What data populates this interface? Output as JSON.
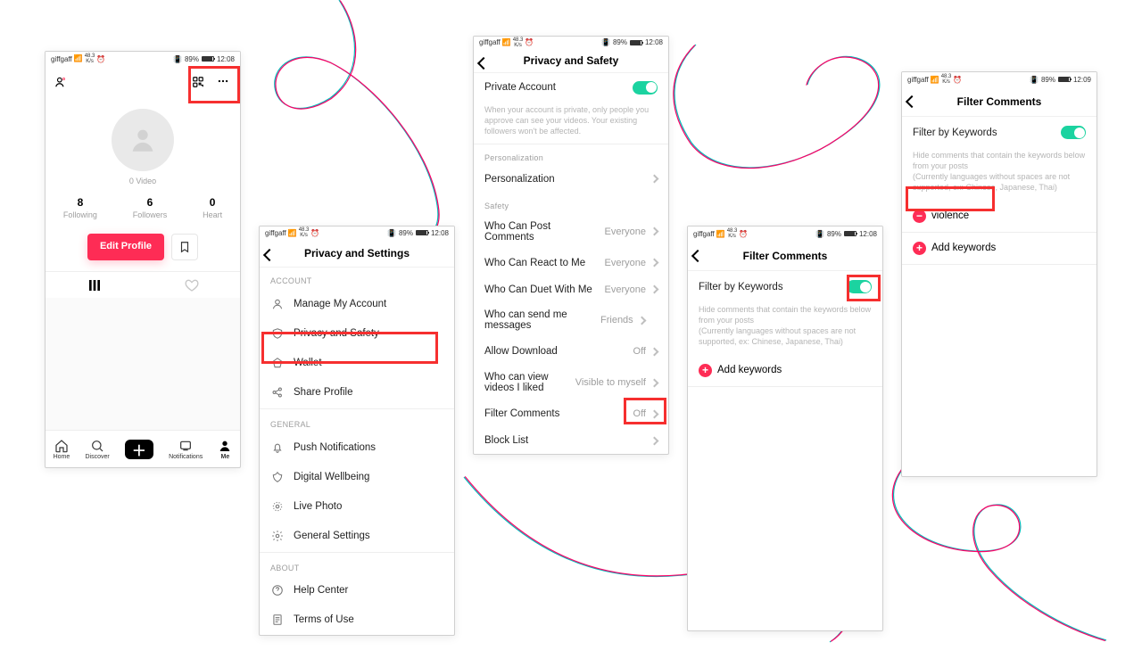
{
  "status": {
    "carrier": "giffgaff",
    "sig": "⁴ᴳ",
    "kb": "48.3",
    "kb_unit": "K/s",
    "battery": "89%",
    "time": "12:08",
    "time_last": "12:09"
  },
  "profile": {
    "video_count": "0 Video",
    "counts": [
      {
        "n": "8",
        "l": "Following"
      },
      {
        "n": "6",
        "l": "Followers"
      },
      {
        "n": "0",
        "l": "Heart"
      }
    ],
    "edit": "Edit Profile",
    "nav": [
      "Home",
      "Discover",
      "",
      "Notifications",
      "Me"
    ]
  },
  "settings": {
    "title": "Privacy and Settings",
    "sections": {
      "account": {
        "label": "ACCOUNT",
        "items": [
          "Manage My Account",
          "Privacy and Safety",
          "Wallet",
          "Share Profile"
        ]
      },
      "general": {
        "label": "GENERAL",
        "items": [
          "Push Notifications",
          "Digital Wellbeing",
          "Live Photo",
          "General Settings"
        ]
      },
      "about": {
        "label": "ABOUT",
        "items": [
          "Help Center",
          "Terms of Use"
        ]
      }
    }
  },
  "privacy": {
    "title": "Privacy and Safety",
    "private_label": "Private Account",
    "private_desc": "When your account is private, only people you approve can see your videos. Your existing followers won't be affected.",
    "personalization_section": "Personalization",
    "personalization": "Personalization",
    "safety_section": "Safety",
    "safety": [
      {
        "label": "Who Can Post Comments",
        "value": "Everyone"
      },
      {
        "label": "Who Can React to Me",
        "value": "Everyone"
      },
      {
        "label": "Who Can Duet With Me",
        "value": "Everyone"
      },
      {
        "label": "Who can send me messages",
        "value": "Friends"
      },
      {
        "label": "Allow Download",
        "value": "Off"
      },
      {
        "label": "Who can view videos I liked",
        "value": "Visible to myself"
      },
      {
        "label": "Filter Comments",
        "value": "Off"
      },
      {
        "label": "Block List",
        "value": ""
      }
    ]
  },
  "filter": {
    "title": "Filter Comments",
    "filter_label": "Filter by Keywords",
    "filter_desc": "Hide comments that contain the keywords below from your posts\n(Currently languages without spaces are not supported, ex: Chinese, Japanese, Thai)",
    "add": "Add keywords",
    "keyword": "violence"
  }
}
